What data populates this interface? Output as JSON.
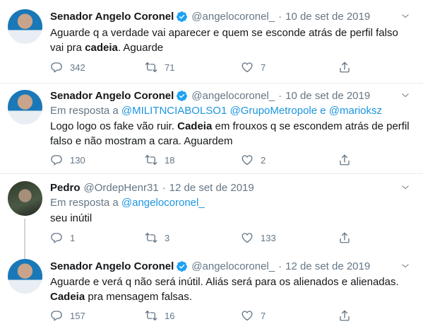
{
  "tweets": [
    {
      "name": "Senador Angelo Coronel",
      "handle": "@angelocoronel_",
      "date": "10 de set de 2019",
      "text_before": "Aguarde q a verdade vai aparecer e quem se esconde atrás de perfil falso vai pra ",
      "text_bold": "cadeia",
      "text_after": ". Aguarde",
      "replies": "342",
      "retweets": "71",
      "likes": "7"
    },
    {
      "name": "Senador Angelo Coronel",
      "handle": "@angelocoronel_",
      "date": "10 de set de 2019",
      "reply_prefix": "Em resposta a ",
      "reply_users": "@MILITNCIABOLSO1 @GrupoMetropole e @marioksz",
      "text_before": "Logo logo os fake vão ruir. ",
      "text_bold": "Cadeia",
      "text_after": " em frouxos q se escondem atrás de perfil falso e não mostram a cara. Aguardem",
      "replies": "130",
      "retweets": "18",
      "likes": "2"
    },
    {
      "name": "Pedro",
      "handle": "@OrdepHenr31",
      "date": "12 de set de 2019",
      "reply_prefix": "Em resposta a ",
      "reply_users": "@angelocoronel_",
      "text_before": "seu inútil",
      "replies": "1",
      "retweets": "3",
      "likes": "133"
    },
    {
      "name": "Senador Angelo Coronel",
      "handle": "@angelocoronel_",
      "date": "12 de set de 2019",
      "text_before": "Aguarde e verá q não será inútil. Aliás será para os alienados e alienadas. ",
      "text_bold": "Cadeia",
      "text_after": " pra mensagem falsas.",
      "replies": "157",
      "retweets": "16",
      "likes": "7"
    }
  ],
  "colors": {
    "accent": "#1b95e0",
    "muted": "#657786",
    "text": "#14171a",
    "verified": "#1da1f2"
  },
  "icons": [
    "verified-badge-icon",
    "chevron-down-icon",
    "reply-icon",
    "retweet-icon",
    "like-icon",
    "share-icon"
  ]
}
